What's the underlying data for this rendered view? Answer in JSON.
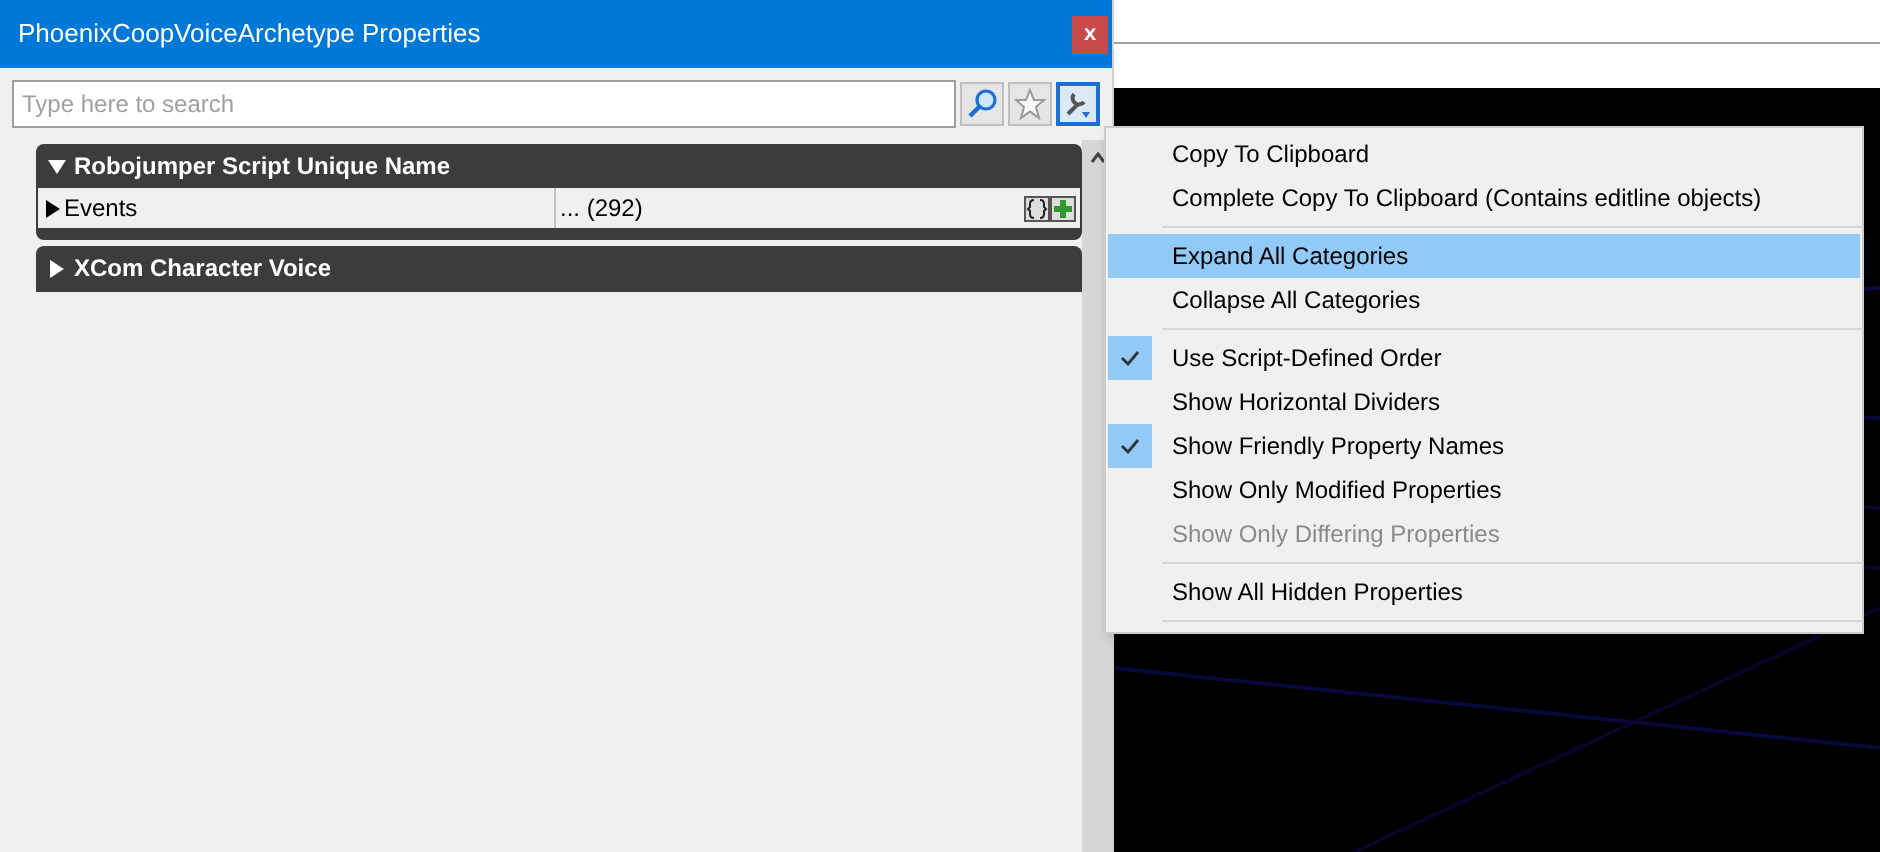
{
  "window": {
    "title": "PhoenixCoopVoiceArchetype Properties",
    "close": "x"
  },
  "search": {
    "placeholder": "Type here to search"
  },
  "categories": [
    {
      "name": "Robojumper Script Unique Name",
      "expanded": true,
      "rows": [
        {
          "name": "Events",
          "expanded": false,
          "value": "... (292)"
        }
      ]
    },
    {
      "name": "XCom Character Voice",
      "expanded": false
    }
  ],
  "menu": [
    {
      "kind": "item",
      "label": "Copy To Clipboard",
      "checked": false,
      "selected": false,
      "disabled": false
    },
    {
      "kind": "item",
      "label": "Complete Copy To Clipboard (Contains editline objects)",
      "checked": false,
      "selected": false,
      "disabled": false
    },
    {
      "kind": "separator"
    },
    {
      "kind": "item",
      "label": "Expand All Categories",
      "checked": false,
      "selected": true,
      "disabled": false
    },
    {
      "kind": "item",
      "label": "Collapse All Categories",
      "checked": false,
      "selected": false,
      "disabled": false
    },
    {
      "kind": "separator"
    },
    {
      "kind": "item",
      "label": "Use Script-Defined Order",
      "checked": true,
      "selected": false,
      "disabled": false
    },
    {
      "kind": "item",
      "label": "Show Horizontal Dividers",
      "checked": false,
      "selected": false,
      "disabled": false
    },
    {
      "kind": "item",
      "label": "Show Friendly Property Names",
      "checked": true,
      "selected": false,
      "disabled": false
    },
    {
      "kind": "item",
      "label": "Show Only Modified Properties",
      "checked": false,
      "selected": false,
      "disabled": false
    },
    {
      "kind": "item",
      "label": "Show Only Differing Properties",
      "checked": false,
      "selected": false,
      "disabled": true
    },
    {
      "kind": "separator"
    },
    {
      "kind": "item",
      "label": "Show All Hidden Properties",
      "checked": false,
      "selected": false,
      "disabled": false
    },
    {
      "kind": "separator"
    }
  ]
}
